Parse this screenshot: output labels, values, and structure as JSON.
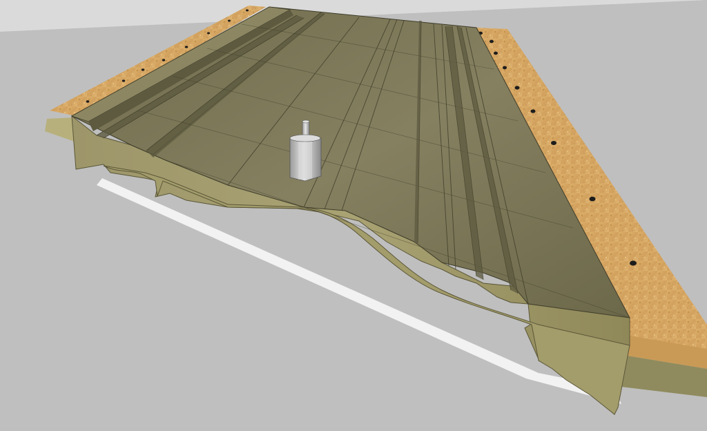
{
  "scene": {
    "colors": {
      "ground": "#bfbfbf",
      "ground_far": "#d6d6d6",
      "board_top": "#7a7554",
      "board_top_light": "#8e8966",
      "board_side": "#a59e6c",
      "board_side_dark": "#8a8455",
      "groove_shadow": "#5d5a40",
      "panel_lines": "#3e3c2a",
      "particle_board": "#d9aa62",
      "particle_board_dark": "#b8874a",
      "particle_edge": "#c89a55",
      "white_base": "#f2f2f2",
      "router_bit": "#c8c8c8",
      "router_bit_dark": "#9a9a9a",
      "screw_hole": "#1c1c1c"
    },
    "objects": [
      {
        "name": "floor-plane",
        "label": ""
      },
      {
        "name": "particle-board-base",
        "label": ""
      },
      {
        "name": "molding-board",
        "label": ""
      },
      {
        "name": "router-bit",
        "label": ""
      }
    ]
  }
}
